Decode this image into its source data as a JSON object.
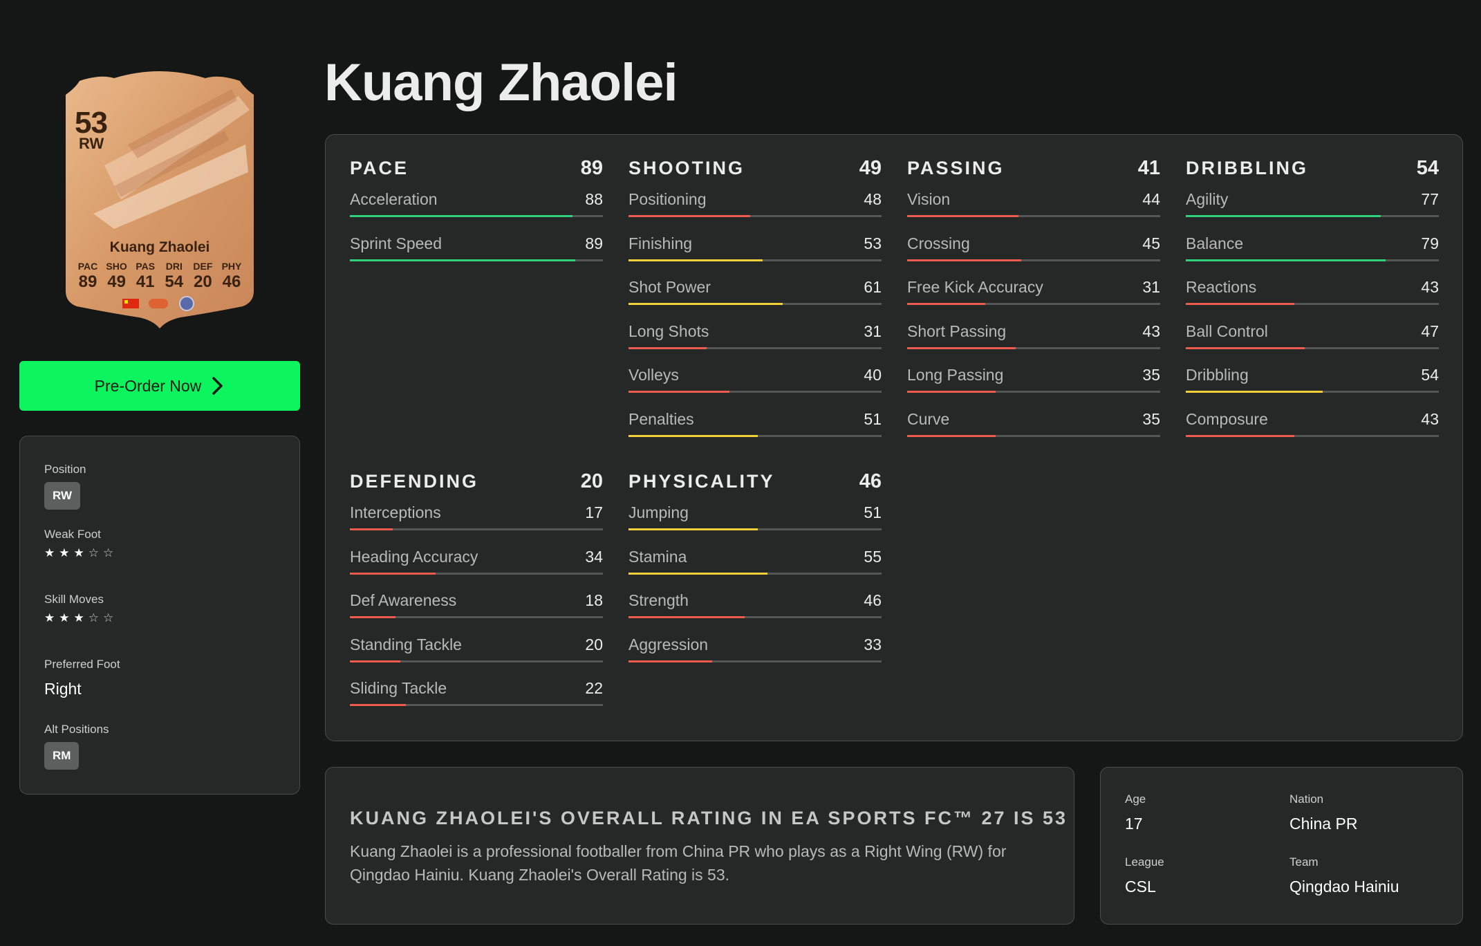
{
  "player": {
    "name": "Kuang Zhaolei"
  },
  "card": {
    "overall": "53",
    "position": "RW",
    "name": "Kuang Zhaolei",
    "stats": [
      {
        "label": "PAC",
        "value": "89"
      },
      {
        "label": "SHO",
        "value": "49"
      },
      {
        "label": "PAS",
        "value": "41"
      },
      {
        "label": "DRI",
        "value": "54"
      },
      {
        "label": "DEF",
        "value": "20"
      },
      {
        "label": "PHY",
        "value": "46"
      }
    ],
    "colors": {
      "base": "#d69866",
      "light": "#f2c7a0",
      "dark": "#b27249"
    }
  },
  "cta": {
    "label": "Pre-Order Now",
    "icon": "chevron-right-icon",
    "color": "#0cf55f"
  },
  "info": {
    "position": {
      "label": "Position",
      "value": "RW"
    },
    "weak_foot": {
      "label": "Weak Foot",
      "rating": 3,
      "max": 5
    },
    "skill_moves": {
      "label": "Skill Moves",
      "rating": 3,
      "max": 5
    },
    "preferred_foot": {
      "label": "Preferred Foot",
      "value": "Right"
    },
    "alt_positions": {
      "label": "Alt Positions",
      "value": "RM"
    }
  },
  "bar_colors": {
    "green": "#2fd27b",
    "yellow": "#f2cf3a",
    "red": "#ee5a4d",
    "track": "#555656"
  },
  "stat_groups": [
    {
      "name": "PACE",
      "value": "89",
      "attrs": [
        {
          "name": "Acceleration",
          "value": "88"
        },
        {
          "name": "Sprint Speed",
          "value": "89"
        }
      ]
    },
    {
      "name": "SHOOTING",
      "value": "49",
      "attrs": [
        {
          "name": "Positioning",
          "value": "48"
        },
        {
          "name": "Finishing",
          "value": "53"
        },
        {
          "name": "Shot Power",
          "value": "61"
        },
        {
          "name": "Long Shots",
          "value": "31"
        },
        {
          "name": "Volleys",
          "value": "40"
        },
        {
          "name": "Penalties",
          "value": "51"
        }
      ]
    },
    {
      "name": "PASSING",
      "value": "41",
      "attrs": [
        {
          "name": "Vision",
          "value": "44"
        },
        {
          "name": "Crossing",
          "value": "45"
        },
        {
          "name": "Free Kick Accuracy",
          "value": "31"
        },
        {
          "name": "Short Passing",
          "value": "43"
        },
        {
          "name": "Long Passing",
          "value": "35"
        },
        {
          "name": "Curve",
          "value": "35"
        }
      ]
    },
    {
      "name": "DRIBBLING",
      "value": "54",
      "attrs": [
        {
          "name": "Agility",
          "value": "77"
        },
        {
          "name": "Balance",
          "value": "79"
        },
        {
          "name": "Reactions",
          "value": "43"
        },
        {
          "name": "Ball Control",
          "value": "47"
        },
        {
          "name": "Dribbling",
          "value": "54"
        },
        {
          "name": "Composure",
          "value": "43"
        }
      ]
    },
    {
      "name": "DEFENDING",
      "value": "20",
      "attrs": [
        {
          "name": "Interceptions",
          "value": "17"
        },
        {
          "name": "Heading Accuracy",
          "value": "34"
        },
        {
          "name": "Def Awareness",
          "value": "18"
        },
        {
          "name": "Standing Tackle",
          "value": "20"
        },
        {
          "name": "Sliding Tackle",
          "value": "22"
        }
      ]
    },
    {
      "name": "PHYSICALITY",
      "value": "46",
      "attrs": [
        {
          "name": "Jumping",
          "value": "51"
        },
        {
          "name": "Stamina",
          "value": "55"
        },
        {
          "name": "Strength",
          "value": "46"
        },
        {
          "name": "Aggression",
          "value": "33"
        }
      ]
    }
  ],
  "rating_card": {
    "heading": "Kuang Zhaolei's Overall Rating in EA SPORTS FC™ 27 is 53",
    "description": "Kuang Zhaolei is a professional footballer from China PR who plays as a Right Wing (RW) for Qingdao Hainiu. Kuang Zhaolei's Overall Rating is 53."
  },
  "bio": {
    "age": {
      "label": "Age",
      "value": "17"
    },
    "nation": {
      "label": "Nation",
      "value": "China PR"
    },
    "league": {
      "label": "League",
      "value": "CSL"
    },
    "team": {
      "label": "Team",
      "value": "Qingdao Hainiu"
    }
  }
}
